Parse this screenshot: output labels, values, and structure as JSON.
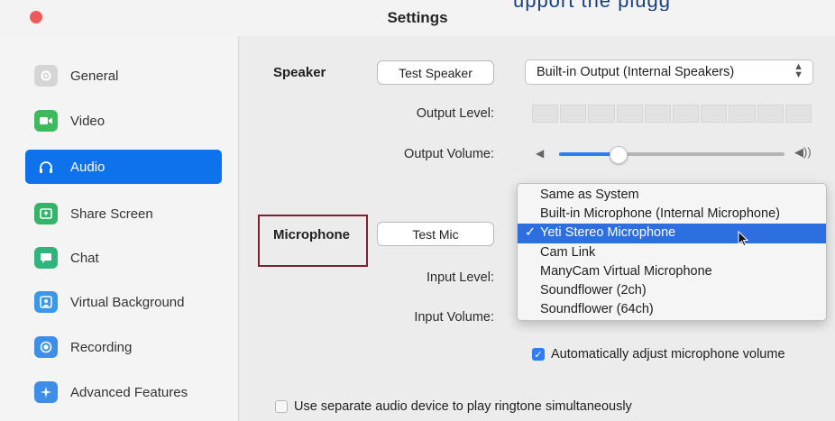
{
  "window": {
    "title": "Settings",
    "banner_text": "upport the plugg"
  },
  "sidebar": {
    "items": [
      {
        "label": "General"
      },
      {
        "label": "Video"
      },
      {
        "label": "Audio"
      },
      {
        "label": "Share Screen"
      },
      {
        "label": "Chat"
      },
      {
        "label": "Virtual Background"
      },
      {
        "label": "Recording"
      },
      {
        "label": "Advanced Features"
      }
    ],
    "active": "Audio"
  },
  "speaker": {
    "label": "Speaker",
    "test_button": "Test Speaker",
    "device": "Built-in Output (Internal Speakers)",
    "output_level_label": "Output Level:",
    "output_volume_label": "Output Volume:",
    "output_volume_fraction": 0.26
  },
  "microphone": {
    "label": "Microphone",
    "test_button": "Test Mic",
    "input_level_label": "Input Level:",
    "input_volume_label": "Input Volume:",
    "device_options": [
      "Same as System",
      "Built-in Microphone (Internal Microphone)",
      "Yeti Stereo Microphone",
      "Cam Link",
      "ManyCam Virtual Microphone",
      "Soundflower (2ch)",
      "Soundflower (64ch)"
    ],
    "selected_option": "Yeti Stereo Microphone",
    "selected_check": "✓",
    "auto_adjust_label": "Automatically adjust microphone volume",
    "auto_adjust_checked": true
  },
  "ringtone": {
    "label": "Use separate audio device to play ringtone simultaneously",
    "checked": false
  },
  "colors": {
    "accent": "#0e72ed",
    "selection": "#2d6fe0",
    "highlight_box": "#7e1f33"
  }
}
